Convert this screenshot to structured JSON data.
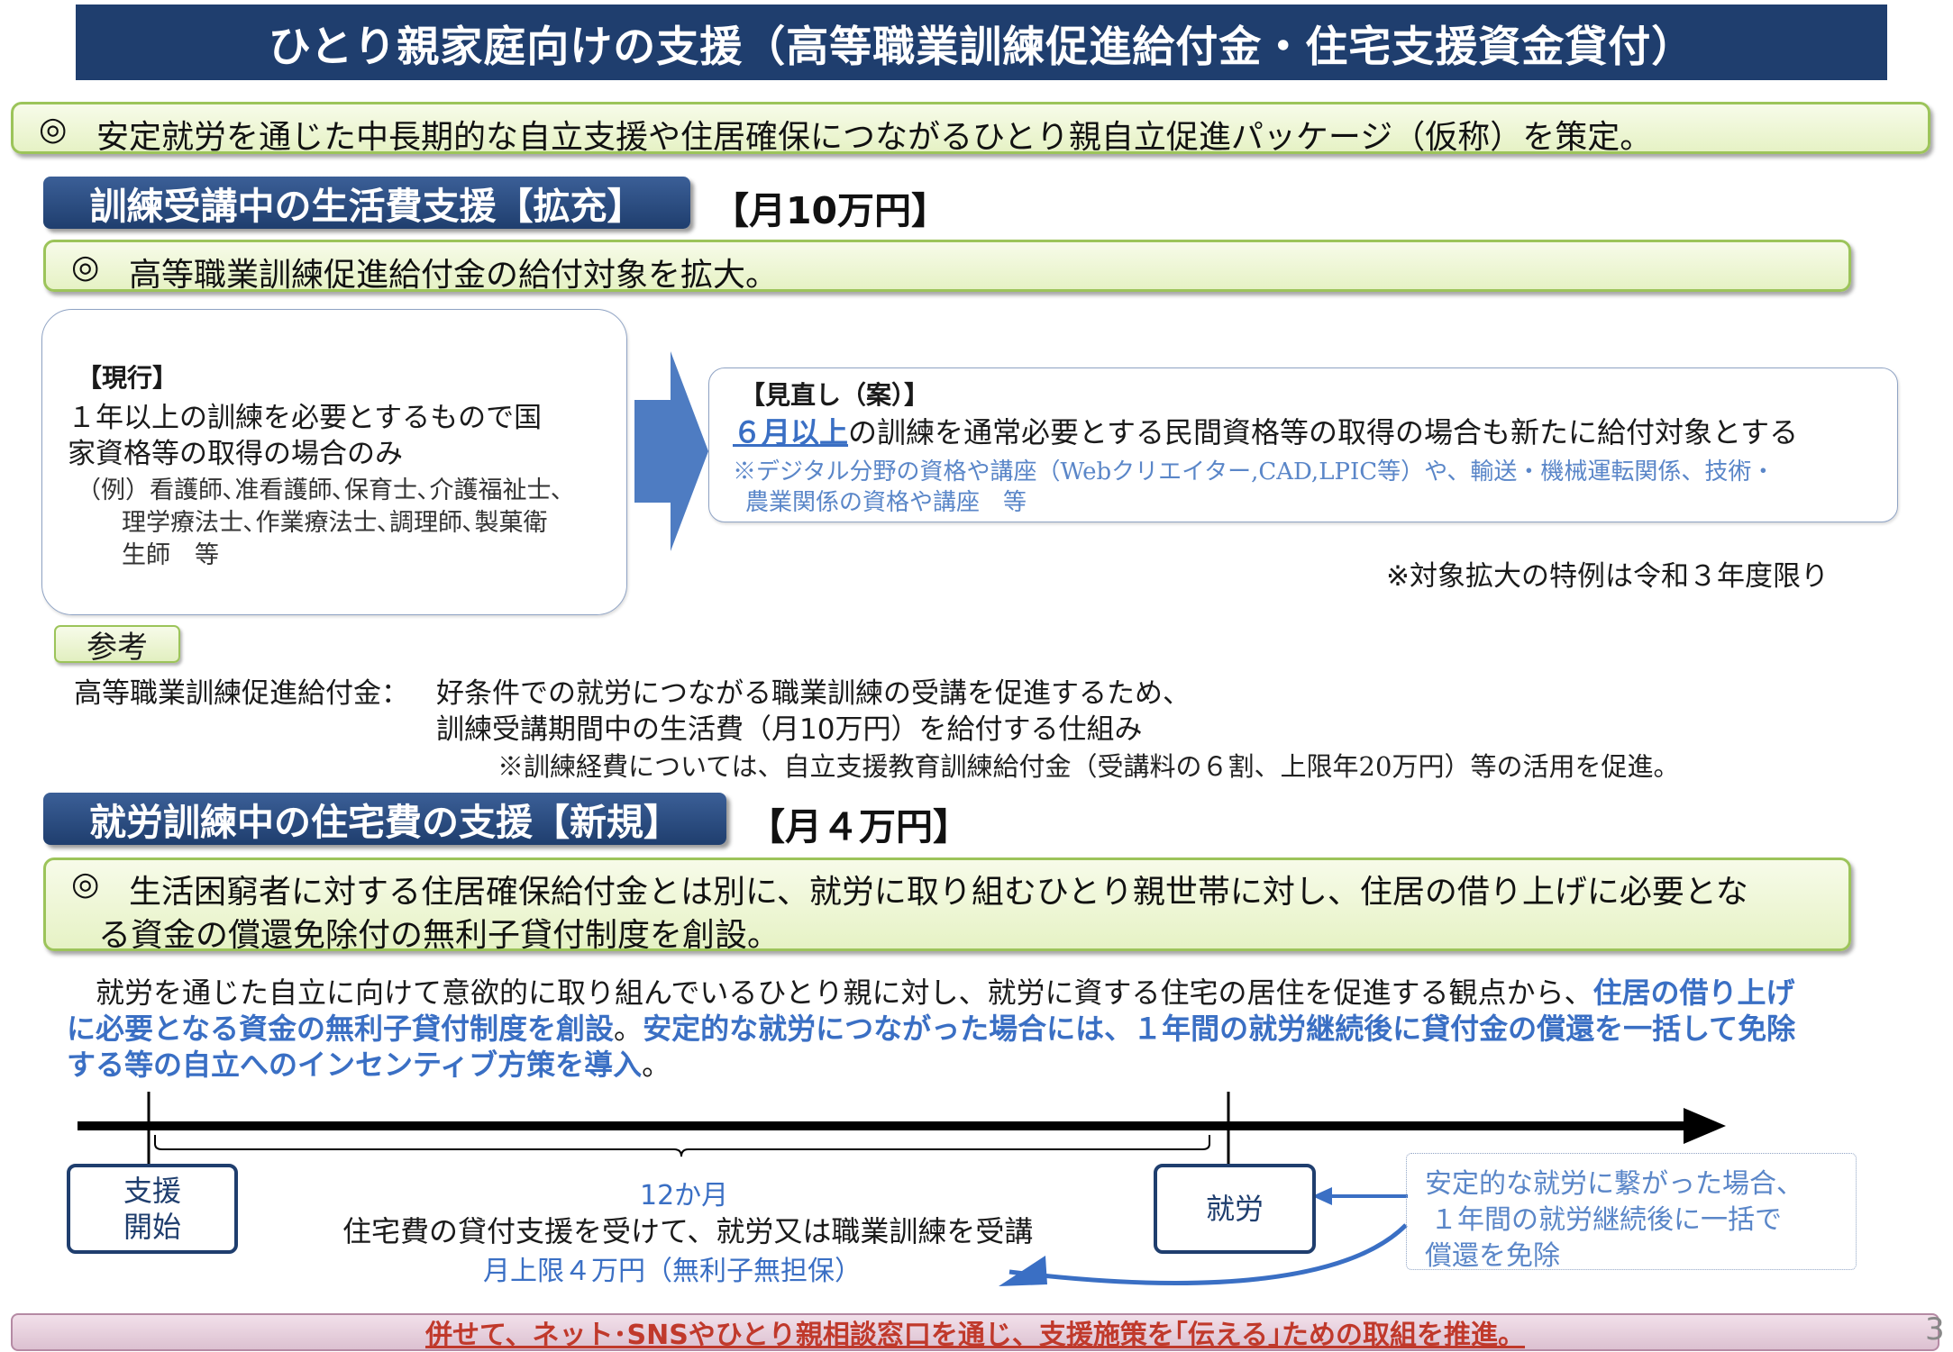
{
  "title": "ひとり親家庭向けの支援（高等職業訓練促進給付金・住宅支援資金貸付）",
  "intro": {
    "mark": "◎",
    "text": "安定就労を通じた中長期的な自立支援や住居確保につながるひとり親自立促進パッケージ（仮称）を策定。"
  },
  "section1": {
    "header": "訓練受講中の生活費支援【拡充】",
    "amount": "【月10万円】",
    "mark": "◎",
    "summary": "高等職業訓練促進給付金の給付対象を拡大。",
    "current": {
      "heading": "【現行】",
      "line1": "１年以上の訓練を必要とするもので国",
      "line2": "家資格等の取得の場合のみ",
      "example1": "（例）看護師､准看護師､保育士､介護福祉士､",
      "example2": "理学療法士､作業療法士､調理師､製菓衛",
      "example3": "生師　等"
    },
    "review": {
      "heading": "【見直し（案）】",
      "highlight": "６月以上",
      "text": "の訓練を通常必要とする民間資格等の取得の場合も新たに給付対象とする",
      "note1": "※デジタル分野の資格や講座（Webクリエイター,CAD,LPIC等）や、輸送・機械運転関係、技術・",
      "note2": "農業関係の資格や講座　等"
    },
    "special_note": "※対象拡大の特例は令和３年度限り",
    "reference": {
      "tag": "参考",
      "label": "高等職業訓練促進給付金：",
      "line1": "好条件での就労につながる職業訓練の受講を促進するため、",
      "line2": "訓練受講期間中の生活費（月10万円）を給付する仕組み",
      "line3": "※訓練経費については、自立支援教育訓練給付金（受講料の６割、上限年20万円）等の活用を促進。"
    }
  },
  "section2": {
    "header": "就労訓練中の住宅費の支援【新規】",
    "amount": "【月４万円】",
    "mark": "◎",
    "summary1": "生活困窮者に対する住居確保給付金とは別に、就労に取り組むひとり親世帯に対し、住居の借り上げに必要とな",
    "summary2": "る資金の償還免除付の無利子貸付制度を創設。",
    "body": {
      "p1_start": "就労を通じた自立に向けて意欲的に取り組んでいるひとり親に対し、就労に資する住宅の居住を促進する観点から、",
      "p1_bold": "住居の借り上げ",
      "p2_bold_a": "に必要となる資金の無利子貸付制度を創設",
      "p2_sep": "。",
      "p2_bold_b": "安定的な就労につながった場合には、１年間の就労継続後に貸付金の償還を一括して免除",
      "p3_bold": "する等の自立へのインセンティブ方策を導入",
      "p3_end": "。"
    },
    "timeline": {
      "start_label": "支援開始",
      "start_line1": "支援",
      "start_line2": "開始",
      "duration": "12か月",
      "description": "住宅費の貸付支援を受けて、就労又は職業訓練を受講",
      "limit": "月上限４万円（無利子無担保）",
      "work_label": "就労",
      "note1": "安定的な就労に繋がった場合、",
      "note2": "１年間の就労継続後に一括で",
      "note3": "償還を免除"
    }
  },
  "footer": "併せて、ネット･SNSやひとり親相談窓口を通じ、支援施策を｢伝える｣ための取組を推進。",
  "page_number": "3",
  "colors": {
    "navy": "#1f3e6e",
    "accent_blue": "#3a6fc4",
    "green_border": "#9cc45a",
    "footer_red": "#c0392b"
  }
}
